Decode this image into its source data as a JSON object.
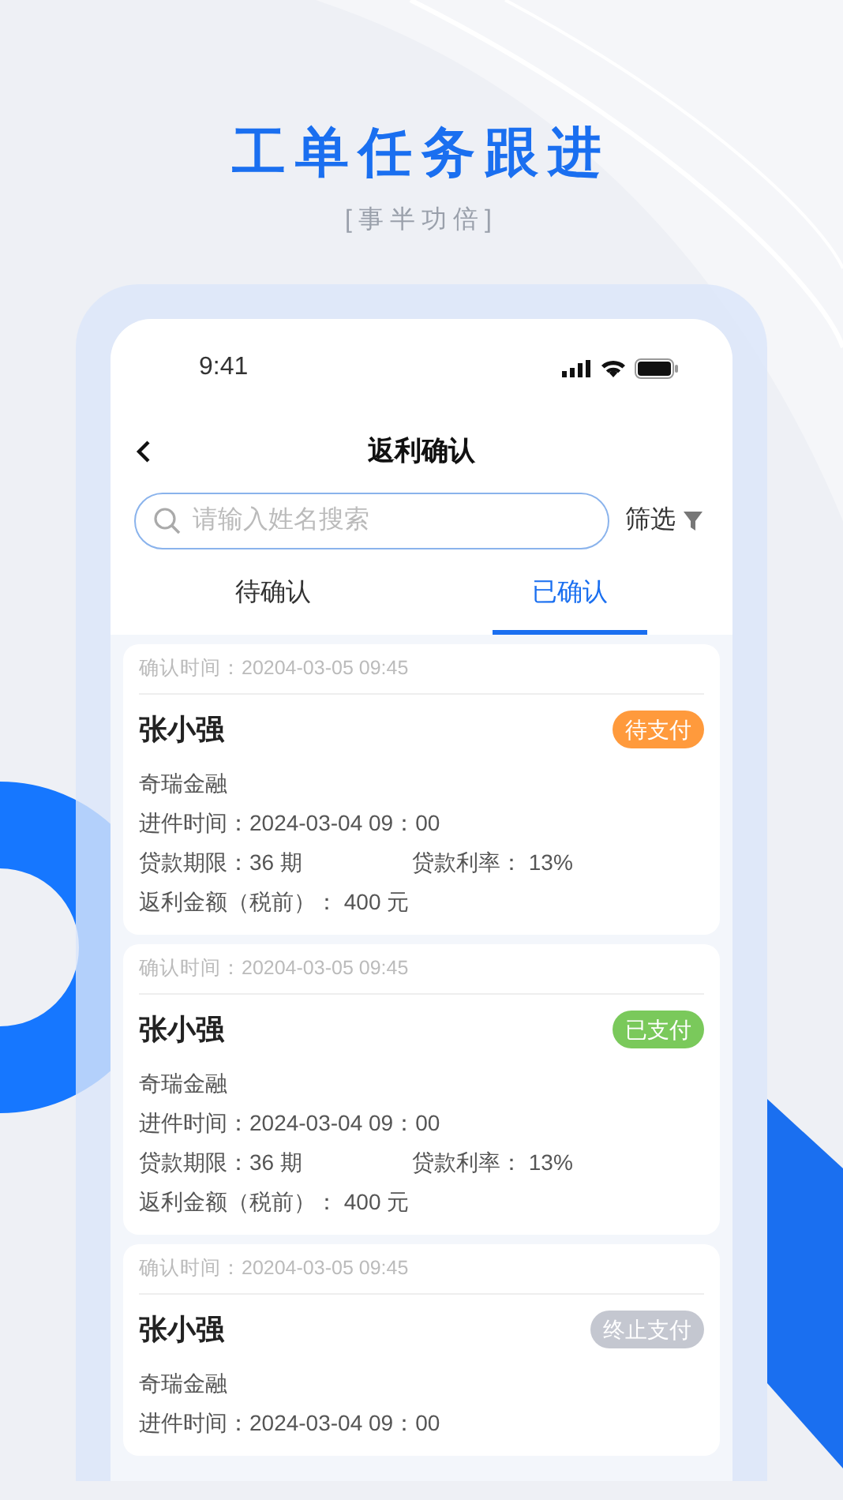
{
  "headline": "工单任务跟进",
  "tagline": "[事半功倍]",
  "status_bar": {
    "time": "9:41"
  },
  "nav": {
    "title": "返利确认"
  },
  "search": {
    "placeholder": "请输入姓名搜索"
  },
  "filter": {
    "label": "筛选"
  },
  "tabs": [
    {
      "label": "待确认",
      "selected": false
    },
    {
      "label": "已确认",
      "selected": true
    }
  ],
  "cards": [
    {
      "confirm_time": "确认时间：20204-03-05 09:45",
      "name": "张小强",
      "status": {
        "label": "待支付",
        "kind": "pending"
      },
      "company": "奇瑞金融",
      "submit_time": "进件时间：2024-03-04 09：00",
      "term": "贷款期限：36 期",
      "rate": "贷款利率： 13%",
      "rebate": "返利金额（税前）： 400 元"
    },
    {
      "confirm_time": "确认时间：20204-03-05 09:45",
      "name": "张小强",
      "status": {
        "label": "已支付",
        "kind": "paid"
      },
      "company": "奇瑞金融",
      "submit_time": "进件时间：2024-03-04 09：00",
      "term": "贷款期限：36 期",
      "rate": "贷款利率： 13%",
      "rebate": "返利金额（税前）： 400 元"
    },
    {
      "confirm_time": "确认时间：20204-03-05 09:45",
      "name": "张小强",
      "status": {
        "label": "终止支付",
        "kind": "stopped"
      },
      "company": "奇瑞金融",
      "submit_time": "进件时间：2024-03-04 09：00"
    }
  ]
}
